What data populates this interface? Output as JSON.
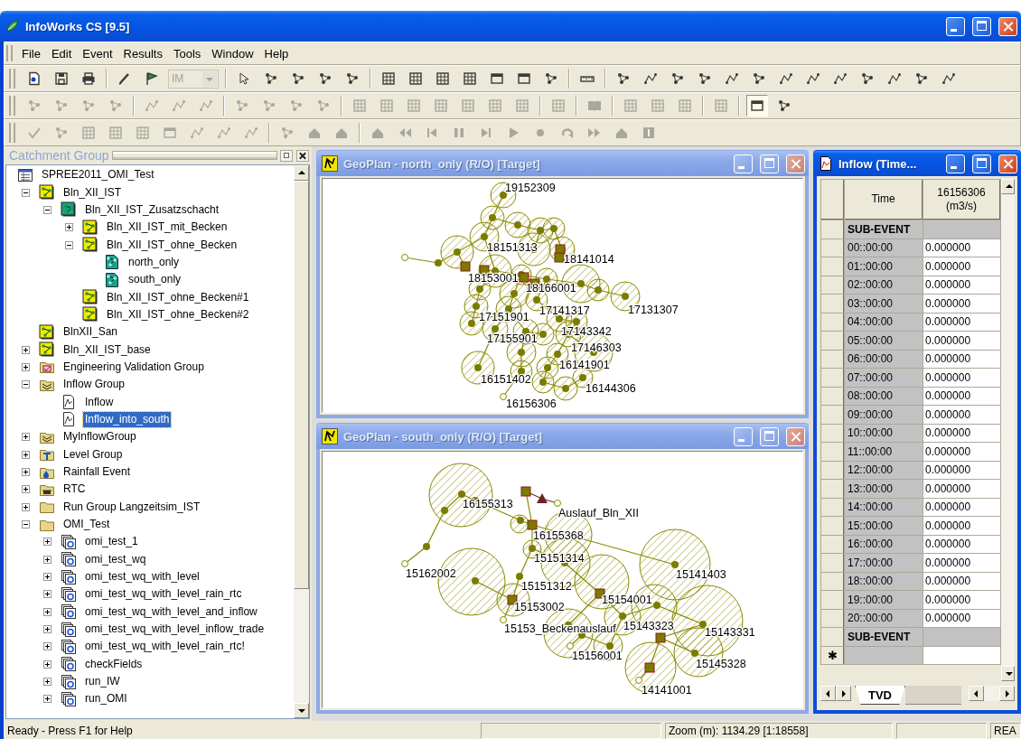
{
  "window": {
    "title": "InfoWorks CS [9.5]",
    "active": true
  },
  "menu": [
    "File",
    "Edit",
    "Event",
    "Results",
    "Tools",
    "Window",
    "Help"
  ],
  "toolbars": [
    {
      "items": [
        {
          "kind": "button",
          "disabled": false,
          "pressed": false
        },
        {
          "kind": "button",
          "disabled": false,
          "pressed": false
        },
        {
          "kind": "button",
          "disabled": false,
          "pressed": false
        },
        {
          "kind": "separator"
        },
        {
          "kind": "button",
          "disabled": false,
          "pressed": false
        },
        {
          "kind": "button",
          "disabled": false,
          "pressed": false
        },
        {
          "kind": "combo",
          "value": "IM",
          "disabled": true
        },
        {
          "kind": "separator"
        },
        {
          "kind": "button",
          "disabled": false,
          "pressed": false
        },
        {
          "kind": "button",
          "disabled": false,
          "pressed": false
        },
        {
          "kind": "button",
          "disabled": false,
          "pressed": false
        },
        {
          "kind": "button",
          "disabled": false,
          "pressed": false
        },
        {
          "kind": "button",
          "disabled": false,
          "pressed": false
        },
        {
          "kind": "separator"
        },
        {
          "kind": "button",
          "disabled": false,
          "pressed": false
        },
        {
          "kind": "button",
          "disabled": false,
          "pressed": false
        },
        {
          "kind": "button",
          "disabled": false,
          "pressed": false
        },
        {
          "kind": "button",
          "disabled": false,
          "pressed": false
        },
        {
          "kind": "button",
          "disabled": false,
          "pressed": false
        },
        {
          "kind": "button",
          "disabled": false,
          "pressed": false
        },
        {
          "kind": "button",
          "disabled": false,
          "pressed": false
        },
        {
          "kind": "separator"
        },
        {
          "kind": "button",
          "disabled": false,
          "pressed": false
        },
        {
          "kind": "separator"
        },
        {
          "kind": "button",
          "disabled": false,
          "pressed": false
        },
        {
          "kind": "button",
          "disabled": false,
          "pressed": false
        },
        {
          "kind": "button",
          "disabled": false,
          "pressed": false
        },
        {
          "kind": "button",
          "disabled": false,
          "pressed": false
        },
        {
          "kind": "button",
          "disabled": false,
          "pressed": false
        },
        {
          "kind": "button",
          "disabled": false,
          "pressed": false
        },
        {
          "kind": "button",
          "disabled": false,
          "pressed": false
        },
        {
          "kind": "button",
          "disabled": false,
          "pressed": false
        },
        {
          "kind": "button",
          "disabled": false,
          "pressed": false
        },
        {
          "kind": "button",
          "disabled": false,
          "pressed": false
        },
        {
          "kind": "button",
          "disabled": false,
          "pressed": false
        },
        {
          "kind": "button",
          "disabled": false,
          "pressed": false
        },
        {
          "kind": "button",
          "disabled": false,
          "pressed": false
        }
      ]
    },
    {
      "items": [
        {
          "kind": "button",
          "disabled": true,
          "pressed": false
        },
        {
          "kind": "button",
          "disabled": true,
          "pressed": false
        },
        {
          "kind": "button",
          "disabled": true,
          "pressed": false
        },
        {
          "kind": "button",
          "disabled": true,
          "pressed": false
        },
        {
          "kind": "separator"
        },
        {
          "kind": "button",
          "disabled": true,
          "pressed": false
        },
        {
          "kind": "button",
          "disabled": true,
          "pressed": false
        },
        {
          "kind": "button",
          "disabled": true,
          "pressed": false
        },
        {
          "kind": "separator"
        },
        {
          "kind": "button",
          "disabled": true,
          "pressed": false
        },
        {
          "kind": "button",
          "disabled": true,
          "pressed": false
        },
        {
          "kind": "button",
          "disabled": true,
          "pressed": false
        },
        {
          "kind": "button",
          "disabled": true,
          "pressed": false
        },
        {
          "kind": "separator"
        },
        {
          "kind": "button",
          "disabled": true,
          "pressed": false
        },
        {
          "kind": "button",
          "disabled": true,
          "pressed": false
        },
        {
          "kind": "button",
          "disabled": true,
          "pressed": false
        },
        {
          "kind": "button",
          "disabled": true,
          "pressed": false
        },
        {
          "kind": "button",
          "disabled": true,
          "pressed": false
        },
        {
          "kind": "button",
          "disabled": true,
          "pressed": false
        },
        {
          "kind": "button",
          "disabled": true,
          "pressed": false
        },
        {
          "kind": "separator"
        },
        {
          "kind": "button",
          "disabled": true,
          "pressed": false
        },
        {
          "kind": "separator"
        },
        {
          "kind": "button",
          "disabled": true,
          "pressed": false
        },
        {
          "kind": "separator"
        },
        {
          "kind": "button",
          "disabled": true,
          "pressed": false
        },
        {
          "kind": "button",
          "disabled": true,
          "pressed": false
        },
        {
          "kind": "button",
          "disabled": true,
          "pressed": false
        },
        {
          "kind": "separator"
        },
        {
          "kind": "button",
          "disabled": true,
          "pressed": false
        },
        {
          "kind": "separator"
        },
        {
          "kind": "button",
          "disabled": false,
          "pressed": true
        },
        {
          "kind": "button",
          "disabled": false,
          "pressed": false
        }
      ]
    },
    {
      "items": [
        {
          "kind": "button",
          "disabled": true,
          "pressed": false
        },
        {
          "kind": "button",
          "disabled": true,
          "pressed": false
        },
        {
          "kind": "button",
          "disabled": true,
          "pressed": false
        },
        {
          "kind": "button",
          "disabled": true,
          "pressed": false
        },
        {
          "kind": "button",
          "disabled": true,
          "pressed": false
        },
        {
          "kind": "button",
          "disabled": true,
          "pressed": false
        },
        {
          "kind": "button",
          "disabled": true,
          "pressed": false
        },
        {
          "kind": "button",
          "disabled": true,
          "pressed": false
        },
        {
          "kind": "button",
          "disabled": true,
          "pressed": false
        },
        {
          "kind": "separator"
        },
        {
          "kind": "button",
          "disabled": true,
          "pressed": false
        },
        {
          "kind": "button",
          "disabled": true,
          "pressed": false
        },
        {
          "kind": "button",
          "disabled": true,
          "pressed": false
        },
        {
          "kind": "separator"
        },
        {
          "kind": "button",
          "disabled": true,
          "pressed": false
        },
        {
          "kind": "button",
          "disabled": true,
          "pressed": false
        },
        {
          "kind": "button",
          "disabled": true,
          "pressed": false
        },
        {
          "kind": "button",
          "disabled": true,
          "pressed": false
        },
        {
          "kind": "button",
          "disabled": true,
          "pressed": false
        },
        {
          "kind": "button",
          "disabled": true,
          "pressed": false
        },
        {
          "kind": "button",
          "disabled": true,
          "pressed": false
        },
        {
          "kind": "button",
          "disabled": true,
          "pressed": false
        },
        {
          "kind": "button",
          "disabled": true,
          "pressed": false
        },
        {
          "kind": "button",
          "disabled": true,
          "pressed": false
        },
        {
          "kind": "button",
          "disabled": true,
          "pressed": false
        }
      ]
    }
  ],
  "catchment_panel": {
    "title": "Catchment Group",
    "tree": [
      {
        "label": "SPREE2011_OMI_Test",
        "kind": "database",
        "selected": false,
        "children": [
          {
            "label": "Bln_XII_IST",
            "kind": "network",
            "expanded": true,
            "selected": false,
            "children": [
              {
                "label": "Bln_XII_IST_Zusatzschacht",
                "kind": "catchment",
                "expanded": true,
                "selected": false,
                "children": [
                  {
                    "label": "Bln_XII_IST_mit_Becken",
                    "kind": "network",
                    "expanded": false,
                    "selected": false
                  },
                  {
                    "label": "Bln_XII_IST_ohne_Becken",
                    "kind": "network",
                    "expanded": true,
                    "selected": false,
                    "children": [
                      {
                        "label": "north_only",
                        "kind": "model",
                        "selected": false
                      },
                      {
                        "label": "south_only",
                        "kind": "model",
                        "selected": false
                      }
                    ]
                  },
                  {
                    "label": "Bln_XII_IST_ohne_Becken#1",
                    "kind": "network",
                    "selected": false
                  },
                  {
                    "label": "Bln_XII_IST_ohne_Becken#2",
                    "kind": "network",
                    "selected": false
                  }
                ]
              }
            ]
          },
          {
            "label": "BlnXII_San",
            "kind": "network",
            "selected": false
          },
          {
            "label": "Bln_XII_IST_base",
            "kind": "network",
            "expanded": false,
            "selected": false
          },
          {
            "label": "Engineering Validation Group",
            "kind": "validation-group",
            "expanded": false,
            "selected": false
          },
          {
            "label": "Inflow Group",
            "kind": "inflow-group",
            "expanded": true,
            "selected": false,
            "children": [
              {
                "label": "Inflow",
                "kind": "inflow",
                "selected": false
              },
              {
                "label": "Inflow_into_south",
                "kind": "inflow",
                "selected": true
              }
            ]
          },
          {
            "label": "MyInflowGroup",
            "kind": "inflow-group",
            "expanded": false,
            "selected": false
          },
          {
            "label": "Level Group",
            "kind": "level-group",
            "expanded": false,
            "selected": false
          },
          {
            "label": "Rainfall Event",
            "kind": "rainfall-group",
            "expanded": false,
            "selected": false
          },
          {
            "label": "RTC",
            "kind": "rtc-group",
            "expanded": false,
            "selected": false
          },
          {
            "label": "Run Group Langzeitsim_IST",
            "kind": "folder",
            "expanded": false,
            "selected": false
          },
          {
            "label": "OMI_Test",
            "kind": "folder",
            "expanded": true,
            "selected": false,
            "children": [
              {
                "label": "omi_test_1",
                "kind": "run",
                "expanded": false,
                "selected": false
              },
              {
                "label": "omi_test_wq",
                "kind": "run",
                "expanded": false,
                "selected": false
              },
              {
                "label": "omi_test_wq_with_level",
                "kind": "run",
                "expanded": false,
                "selected": false
              },
              {
                "label": "omi_test_wq_with_level_rain_rtc",
                "kind": "run",
                "expanded": false,
                "selected": false
              },
              {
                "label": "omi_test_wq_with_level_and_inflow",
                "kind": "run",
                "expanded": false,
                "selected": false
              },
              {
                "label": "omi_test_wq_with_level_inflow_trade",
                "kind": "run",
                "expanded": false,
                "selected": false
              },
              {
                "label": "omi_test_wq_with_level_rain_rtc!",
                "kind": "run",
                "expanded": false,
                "selected": false
              },
              {
                "label": "checkFields",
                "kind": "run",
                "expanded": false,
                "selected": false
              },
              {
                "label": "run_IW",
                "kind": "run",
                "expanded": false,
                "selected": false
              },
              {
                "label": "run_OMI",
                "kind": "run",
                "expanded": false,
                "selected": false
              }
            ]
          }
        ]
      }
    ]
  },
  "geoplan_windows": [
    {
      "title": "GeoPlan - north_only (R/O) [Target]",
      "active": false,
      "node_labels": [
        "19152309",
        "18151313",
        "18141014",
        "18153001",
        "18166001",
        "17151901",
        "17141317",
        "17131307",
        "17143342",
        "17155901",
        "17146303",
        "16141901",
        "16151402",
        "16144306",
        "16156306"
      ]
    },
    {
      "title": "GeoPlan - south_only (R/O) [Target]",
      "active": false,
      "node_labels": [
        "16155313",
        "Auslauf_Bln_XII",
        "16155368",
        "15151314",
        "15162002",
        "15141403",
        "15151312",
        "15154001",
        "15153002",
        "15153_Beckenauslauf",
        "15143323",
        "15143331",
        "15156001",
        "15145328",
        "14141001"
      ]
    }
  ],
  "inflow_window": {
    "title": "Inflow (Time...",
    "active": true,
    "columns": [
      "Time",
      "16156306 (m3/s)"
    ],
    "rows": [
      {
        "kind": "sub-event",
        "time": "SUB-EVENT"
      },
      {
        "kind": "data",
        "time": "00::00:00",
        "value": "0.000000"
      },
      {
        "kind": "data",
        "time": "01::00:00",
        "value": "0.000000"
      },
      {
        "kind": "data",
        "time": "02::00:00",
        "value": "0.000000"
      },
      {
        "kind": "data",
        "time": "03::00:00",
        "value": "0.000000"
      },
      {
        "kind": "data",
        "time": "04::00:00",
        "value": "0.000000"
      },
      {
        "kind": "data",
        "time": "05::00:00",
        "value": "0.000000"
      },
      {
        "kind": "data",
        "time": "06::00:00",
        "value": "0.000000"
      },
      {
        "kind": "data",
        "time": "07::00:00",
        "value": "0.000000"
      },
      {
        "kind": "data",
        "time": "08::00:00",
        "value": "0.000000"
      },
      {
        "kind": "data",
        "time": "09::00:00",
        "value": "0.000000"
      },
      {
        "kind": "data",
        "time": "10::00:00",
        "value": "0.000000"
      },
      {
        "kind": "data",
        "time": "11::00:00",
        "value": "0.000000"
      },
      {
        "kind": "data",
        "time": "12::00:00",
        "value": "0.000000"
      },
      {
        "kind": "data",
        "time": "13::00:00",
        "value": "0.000000"
      },
      {
        "kind": "data",
        "time": "14::00:00",
        "value": "0.000000"
      },
      {
        "kind": "data",
        "time": "15::00:00",
        "value": "0.000000"
      },
      {
        "kind": "data",
        "time": "16::00:00",
        "value": "0.000000"
      },
      {
        "kind": "data",
        "time": "17::00:00",
        "value": "0.000000"
      },
      {
        "kind": "data",
        "time": "18::00:00",
        "value": "0.000000"
      },
      {
        "kind": "data",
        "time": "19::00:00",
        "value": "0.000000"
      },
      {
        "kind": "data",
        "time": "20::00:00",
        "value": "0.000000"
      },
      {
        "kind": "sub-event",
        "time": "SUB-EVENT"
      },
      {
        "kind": "new",
        "marker": "✱"
      }
    ],
    "tabs": [
      {
        "label": "TVD",
        "selected": true
      }
    ]
  },
  "status_bar": {
    "message": "Ready - Press F1 for Help",
    "zoom": "Zoom (m): 1134.29 [1:18558]",
    "mode": "REA"
  }
}
